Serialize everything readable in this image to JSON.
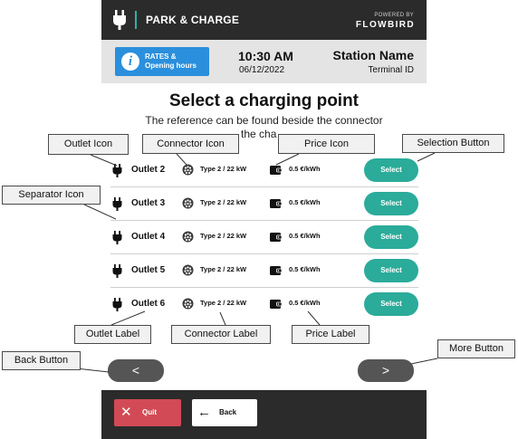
{
  "header": {
    "title": "PARK & CHARGE",
    "powered_by": "POWERED BY",
    "brand": "FLOWBIRD",
    "logo_icon": "plug-icon"
  },
  "info_bar": {
    "rates_button": {
      "label": "RATES &\nOpening hours",
      "icon": "info-icon",
      "icon_glyph": "i"
    },
    "time": "10:30 AM",
    "date": "06/12/2022",
    "station_name": "Station Name",
    "terminal_id": "Terminal ID"
  },
  "page": {
    "heading": "Select a charging point",
    "subtitle_line1": "The reference can be found beside the connector",
    "subtitle_line2": "the cha"
  },
  "outlets": [
    {
      "name": "Outlet 2",
      "connector": "Type 2 / 22 kW",
      "price": "0.5 €/kWh",
      "select_label": "Select"
    },
    {
      "name": "Outlet 3",
      "connector": "Type 2 / 22 kW",
      "price": "0.5 €/kWh",
      "select_label": "Select"
    },
    {
      "name": "Outlet 4",
      "connector": "Type 2 / 22 kW",
      "price": "0.5 €/kWh",
      "select_label": "Select"
    },
    {
      "name": "Outlet 5",
      "connector": "Type 2 / 22 kW",
      "price": "0.5 €/kWh",
      "select_label": "Select"
    },
    {
      "name": "Outlet 6",
      "connector": "Type 2 / 22 kW",
      "price": "0.5 €/kWh",
      "select_label": "Select"
    }
  ],
  "icons": {
    "outlet": "plug-icon",
    "connector": "connector-icon",
    "price": "wallet-icon"
  },
  "navigation": {
    "back_arrow": "<",
    "more_arrow": ">"
  },
  "footer": {
    "quit_label": "Quit",
    "quit_icon": "close-icon",
    "quit_glyph": "✕",
    "back_label": "Back",
    "back_icon": "arrow-left-icon",
    "back_glyph": "←"
  },
  "colors": {
    "bar_dark": "#2b2b2b",
    "accent_teal": "#2bab9a",
    "info_blue": "#2a8fdc",
    "quit_red": "#d24a55",
    "nav_grey": "#555555"
  },
  "annotations": {
    "outlet_icon": "Outlet Icon",
    "connector_icon": "Connector Icon",
    "price_icon": "Price Icon",
    "selection_button": "Selection Button",
    "separator_icon": "Separator Icon",
    "outlet_label": "Outlet Label",
    "connector_label": "Connector Label",
    "price_label": "Price Label",
    "back_button": "Back Button",
    "more_button": "More Button"
  }
}
